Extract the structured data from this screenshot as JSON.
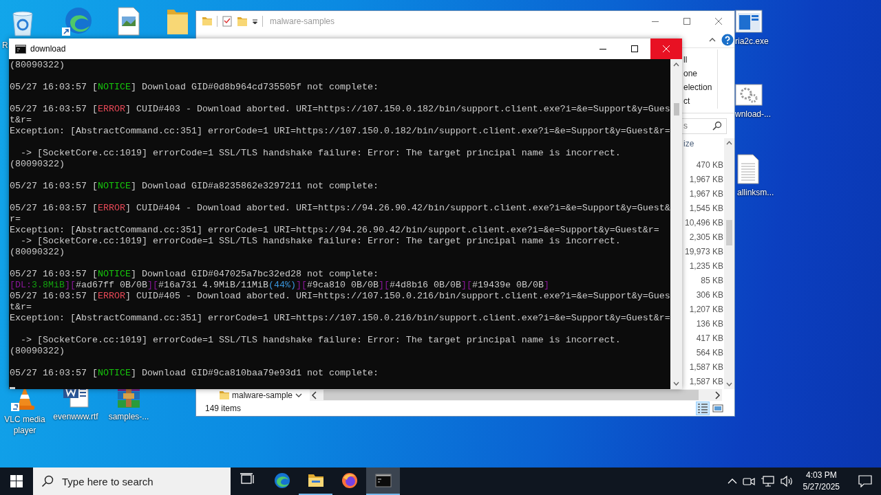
{
  "desktop": {
    "icons": [
      {
        "kind": "recycle",
        "label": "R"
      },
      {
        "kind": "edge"
      },
      {
        "kind": "image"
      },
      {
        "kind": "folder"
      },
      {
        "kind": "exe",
        "label": "ria2c.exe"
      },
      {
        "kind": "gear",
        "label": "wnload-..."
      },
      {
        "kind": "text",
        "label": "allinksm..."
      },
      {
        "kind": "vlc",
        "label": "VLC media player"
      },
      {
        "kind": "word",
        "label": "evenwww.rtf"
      },
      {
        "kind": "winrar",
        "label": "samples-..."
      }
    ]
  },
  "explorer": {
    "title": "malware-samples",
    "ribbon_items": [
      "ll",
      "one",
      "election",
      "ct"
    ],
    "search": {
      "placeholder": "s"
    },
    "size_column": "ize",
    "sizes": [
      "470 KB",
      "1,967 KB",
      "1,967 KB",
      "1,545 KB",
      "10,496 KB",
      "2,305 KB",
      "19,973 KB",
      "1,235 KB",
      "85 KB",
      "306 KB",
      "1,207 KB",
      "136 KB",
      "417 KB",
      "564 KB",
      "1,587 KB",
      "1,587 KB"
    ],
    "breadcrumb": "malware-sample",
    "status": "149 items",
    "views": [
      {
        "kind": "details",
        "selected": true
      },
      {
        "kind": "tiles",
        "selected": false
      }
    ]
  },
  "console": {
    "title": "download",
    "lines": [
      {
        "kind": "text",
        "segments": [
          {
            "text": "(80090322)"
          }
        ]
      },
      {
        "kind": "blank"
      },
      {
        "kind": "text",
        "segments": [
          {
            "text": "05/27 16:03:57 ["
          },
          {
            "text": "NOTICE",
            "color": "#16c60c"
          },
          {
            "text": "] Download GID#0d8b964cd735505f not complete:"
          }
        ]
      },
      {
        "kind": "blank"
      },
      {
        "kind": "text",
        "segments": [
          {
            "text": "05/27 16:03:57 ["
          },
          {
            "text": "ERROR",
            "color": "#e74856"
          },
          {
            "text": "] CUID#403 - Download aborted. URI=https://107.150.0.182/bin/support.client.exe?i=&e=Support&y=Gues"
          }
        ]
      },
      {
        "kind": "text",
        "segments": [
          {
            "text": "t&r="
          }
        ]
      },
      {
        "kind": "text",
        "segments": [
          {
            "text": "Exception: [AbstractCommand.cc:351] errorCode=1 URI=https://107.150.0.182/bin/support.client.exe?i=&e=Support&y=Guest&r="
          }
        ]
      },
      {
        "kind": "blank"
      },
      {
        "kind": "text",
        "segments": [
          {
            "text": "  -> [SocketCore.cc:1019] errorCode=1 SSL/TLS handshake failure: Error: The target principal name is incorrect."
          }
        ]
      },
      {
        "kind": "text",
        "segments": [
          {
            "text": "(80090322)"
          }
        ]
      },
      {
        "kind": "blank"
      },
      {
        "kind": "text",
        "segments": [
          {
            "text": "05/27 16:03:57 ["
          },
          {
            "text": "NOTICE",
            "color": "#16c60c"
          },
          {
            "text": "] Download GID#a8235862e3297211 not complete:"
          }
        ]
      },
      {
        "kind": "blank"
      },
      {
        "kind": "text",
        "segments": [
          {
            "text": "05/27 16:03:57 ["
          },
          {
            "text": "ERROR",
            "color": "#e74856"
          },
          {
            "text": "] CUID#404 - Download aborted. URI=https://94.26.90.42/bin/support.client.exe?i=&e=Support&y=Guest&"
          }
        ]
      },
      {
        "kind": "text",
        "segments": [
          {
            "text": "r="
          }
        ]
      },
      {
        "kind": "text",
        "segments": [
          {
            "text": "Exception: [AbstractCommand.cc:351] errorCode=1 URI=https://94.26.90.42/bin/support.client.exe?i=&e=Support&y=Guest&r="
          }
        ]
      },
      {
        "kind": "text",
        "segments": [
          {
            "text": "  -> [SocketCore.cc:1019] errorCode=1 SSL/TLS handshake failure: Error: The target principal name is incorrect."
          }
        ]
      },
      {
        "kind": "text",
        "segments": [
          {
            "text": "(80090322)"
          }
        ]
      },
      {
        "kind": "blank"
      },
      {
        "kind": "text",
        "segments": [
          {
            "text": "05/27 16:03:57 ["
          },
          {
            "text": "NOTICE",
            "color": "#16c60c"
          },
          {
            "text": "] Download GID#047025a7bc32ed28 not complete:"
          }
        ]
      },
      {
        "kind": "text",
        "segments": [
          {
            "text": "[DL:",
            "color": "#881798"
          },
          {
            "text": "3.8MiB",
            "color": "#13a10e"
          },
          {
            "text": "][",
            "color": "#881798"
          },
          {
            "text": "#ad67ff 0B/0B"
          },
          {
            "text": "][",
            "color": "#881798"
          },
          {
            "text": "#16a731 4.9MiB/11MiB"
          },
          {
            "text": "(44%)",
            "color": "#3a96dd"
          },
          {
            "text": "][",
            "color": "#881798"
          },
          {
            "text": "#9ca810 0B/0B"
          },
          {
            "text": "][",
            "color": "#881798"
          },
          {
            "text": "#4d8b16 0B/0B"
          },
          {
            "text": "][",
            "color": "#881798"
          },
          {
            "text": "#19439e 0B/0B"
          },
          {
            "text": "]",
            "color": "#881798"
          }
        ]
      },
      {
        "kind": "text",
        "segments": [
          {
            "text": "05/27 16:03:57 ["
          },
          {
            "text": "ERROR",
            "color": "#e74856"
          },
          {
            "text": "] CUID#405 - Download aborted. URI=https://107.150.0.216/bin/support.client.exe?i=&e=Support&y=Gues"
          }
        ]
      },
      {
        "kind": "text",
        "segments": [
          {
            "text": "t&r="
          }
        ]
      },
      {
        "kind": "text",
        "segments": [
          {
            "text": "Exception: [AbstractCommand.cc:351] errorCode=1 URI=https://107.150.0.216/bin/support.client.exe?i=&e=Support&y=Guest&r="
          }
        ]
      },
      {
        "kind": "blank"
      },
      {
        "kind": "text",
        "segments": [
          {
            "text": "  -> [SocketCore.cc:1019] errorCode=1 SSL/TLS handshake failure: Error: The target principal name is incorrect."
          }
        ]
      },
      {
        "kind": "text",
        "segments": [
          {
            "text": "(80090322)"
          }
        ]
      },
      {
        "kind": "blank"
      },
      {
        "kind": "text",
        "segments": [
          {
            "text": "05/27 16:03:57 ["
          },
          {
            "text": "NOTICE",
            "color": "#16c60c"
          },
          {
            "text": "] Download GID#9ca810baa79e93d1 not complete:"
          }
        ]
      },
      {
        "kind": "cursor"
      }
    ]
  },
  "taskbar": {
    "search": {
      "placeholder": "Type here to search"
    },
    "apps": [
      {
        "kind": "taskview",
        "running": false,
        "selected": false
      },
      {
        "kind": "edge",
        "running": false,
        "selected": false
      },
      {
        "kind": "explorer",
        "running": true,
        "selected": false
      },
      {
        "kind": "firefox",
        "running": false,
        "selected": false
      },
      {
        "kind": "console",
        "running": true,
        "selected": true
      }
    ],
    "time": "4:03 PM",
    "date": "5/27/2025"
  }
}
